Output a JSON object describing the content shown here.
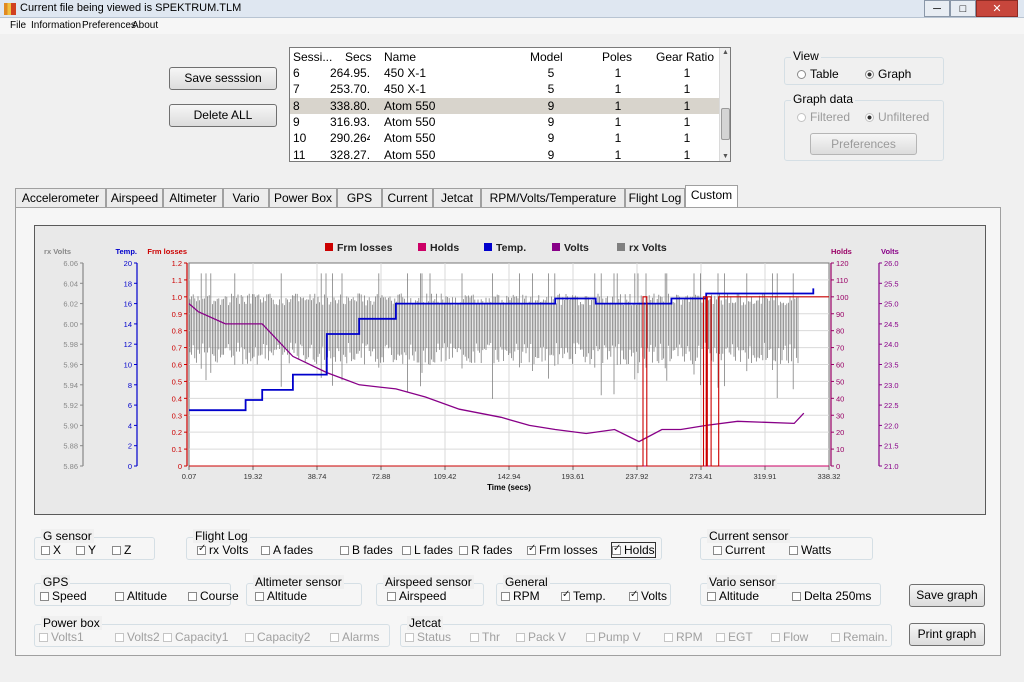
{
  "window": {
    "title": "Current file being viewed is SPEKTRUM.TLM",
    "minimize": "─",
    "maximize": "□",
    "close": "✕"
  },
  "menu": [
    "File",
    "Information",
    "Preferences",
    "About"
  ],
  "buttons": {
    "save_session": "Save sesssion",
    "delete_all": "Delete ALL",
    "preferences": "Preferences",
    "save_graph": "Save graph",
    "print_graph": "Print graph"
  },
  "sessions": {
    "headers": {
      "session": "Sessi...",
      "secs": "Secs",
      "name": "Name",
      "model": "Model",
      "poles": "Poles",
      "gear_ratio": "Gear Ratio"
    },
    "rows": [
      {
        "session": "6",
        "secs": "264.95...",
        "name": "450 X-1",
        "model": "5",
        "poles": "1",
        "gear": "1"
      },
      {
        "session": "7",
        "secs": "253.70...",
        "name": "450 X-1",
        "model": "5",
        "poles": "1",
        "gear": "1"
      },
      {
        "session": "8",
        "secs": "338.80...",
        "name": "Atom 550",
        "model": "9",
        "poles": "1",
        "gear": "1"
      },
      {
        "session": "9",
        "secs": "316.93...",
        "name": "Atom 550",
        "model": "9",
        "poles": "1",
        "gear": "1"
      },
      {
        "session": "10",
        "secs": "290.264",
        "name": "Atom 550",
        "model": "9",
        "poles": "1",
        "gear": "1"
      },
      {
        "session": "11",
        "secs": "328.27...",
        "name": "Atom 550",
        "model": "9",
        "poles": "1",
        "gear": "1"
      }
    ],
    "selected": 2
  },
  "view": {
    "title": "View",
    "table": "Table",
    "graph": "Graph",
    "selected": "graph"
  },
  "graph_data": {
    "title": "Graph data",
    "filtered": "Filtered",
    "unfiltered": "Unfiltered",
    "selected": "unfiltered"
  },
  "tabs": [
    {
      "label": "Accelerometer"
    },
    {
      "label": "Airspeed"
    },
    {
      "label": "Altimeter"
    },
    {
      "label": "Vario"
    },
    {
      "label": "Power Box"
    },
    {
      "label": "GPS"
    },
    {
      "label": "Current"
    },
    {
      "label": "Jetcat"
    },
    {
      "label": "RPM/Volts/Temperature"
    },
    {
      "label": "Flight Log"
    },
    {
      "label": "Custom"
    }
  ],
  "active_tab": 10,
  "chart_data": {
    "type": "line",
    "legend_position": "top",
    "series": [
      {
        "name": "Frm losses",
        "color": "#cc0000",
        "axis": "Frm losses",
        "x": [
          0.07,
          237.92,
          240,
          242,
          270,
          272,
          273.41,
          274,
          276,
          280,
          282,
          338.32
        ],
        "y": [
          0,
          0,
          1.0,
          0,
          0,
          1.0,
          0,
          1.0,
          0,
          1.0,
          1.0,
          1.0
        ]
      },
      {
        "name": "Holds",
        "color": "#cc0066",
        "axis": "Holds",
        "x": [
          0.07,
          338.32
        ],
        "y": [
          0,
          0
        ]
      },
      {
        "name": "Temp.",
        "color": "#0000cc",
        "axis": "Temp.",
        "x": [
          0.07,
          19.32,
          30,
          38.74,
          55,
          72.88,
          90,
          109.42,
          125,
          142.94,
          170,
          193.61,
          215,
          237.92,
          255,
          273.41,
          300,
          319.91,
          330
        ],
        "y": [
          5.5,
          5.5,
          6.5,
          7.5,
          9,
          13,
          14.5,
          16,
          16,
          16,
          16,
          16.5,
          16,
          16,
          16.5,
          17,
          17,
          17,
          17.5
        ]
      },
      {
        "name": "Volts",
        "color": "#880088",
        "axis": "Volts",
        "x": [
          0.07,
          5,
          19.32,
          38.74,
          55,
          72.88,
          90,
          109.42,
          125,
          142.94,
          165,
          180,
          193.61,
          210,
          225,
          237.92,
          250,
          260,
          273.41,
          290,
          319.91,
          325
        ],
        "y": [
          25.0,
          24.8,
          24.5,
          24.5,
          23.7,
          23.3,
          23.0,
          22.9,
          22.7,
          22.4,
          22.2,
          22.0,
          21.9,
          21.8,
          21.9,
          21.6,
          21.9,
          21.9,
          22.0,
          22.1,
          22.05,
          22.3
        ]
      },
      {
        "name": "rx Volts",
        "color": "#808080",
        "axis": "rx Volts",
        "band": [
          5.96,
          6.03
        ]
      }
    ],
    "x_axis": {
      "label": "Time (secs)",
      "ticks": [
        "0.07",
        "19.32",
        "38.74",
        "72.88",
        "109.42",
        "142.94",
        "193.61",
        "237.92",
        "273.41",
        "319.91",
        "338.32"
      ],
      "range": [
        0.07,
        338.32
      ]
    },
    "y_axes": [
      {
        "title": "rx Volts",
        "color": "#888888",
        "range": [
          5.86,
          6.06
        ],
        "ticks": [
          "6.06",
          "6.04",
          "6.02",
          "6.00",
          "5.98",
          "5.96",
          "5.94",
          "5.92",
          "5.90",
          "5.88",
          "5.86"
        ]
      },
      {
        "title": "Temp.",
        "color": "#0000cc",
        "range": [
          0,
          20
        ],
        "ticks": [
          "20",
          "18",
          "16",
          "14",
          "12",
          "10",
          "8",
          "6",
          "4",
          "2",
          "0"
        ]
      },
      {
        "title": "Frm losses",
        "color": "#cc0000",
        "range": [
          0,
          1.2
        ],
        "ticks": [
          "1.2",
          "1.1",
          "1.0",
          "0.9",
          "0.8",
          "0.7",
          "0.6",
          "0.5",
          "0.4",
          "0.3",
          "0.2",
          "0.1",
          "0"
        ]
      },
      {
        "title": "Holds",
        "color": "#990066",
        "range": [
          0,
          120
        ],
        "ticks": [
          "120",
          "110",
          "100",
          "90",
          "80",
          "70",
          "60",
          "50",
          "40",
          "30",
          "20",
          "10",
          "0"
        ]
      },
      {
        "title": "Volts",
        "color": "#880088",
        "range": [
          21.0,
          26.0
        ],
        "ticks": [
          "26.0",
          "25.5",
          "25.0",
          "24.5",
          "24.0",
          "23.5",
          "23.0",
          "22.5",
          "22.0",
          "21.5",
          "21.0"
        ]
      }
    ],
    "grid": true
  },
  "sensor_groups": {
    "g_sensor": {
      "title": "G sensor",
      "items": [
        {
          "label": "X",
          "checked": false
        },
        {
          "label": "Y",
          "checked": false
        },
        {
          "label": "Z",
          "checked": false
        }
      ]
    },
    "flight_log": {
      "title": "Flight Log",
      "items": [
        {
          "label": "rx Volts",
          "checked": true
        },
        {
          "label": "A fades",
          "checked": false
        },
        {
          "label": "B fades",
          "checked": false
        },
        {
          "label": "L fades",
          "checked": false
        },
        {
          "label": "R fades",
          "checked": false
        },
        {
          "label": "Frm losses",
          "checked": true
        },
        {
          "label": "Holds",
          "checked": true
        }
      ]
    },
    "current_sensor": {
      "title": "Current sensor",
      "items": [
        {
          "label": "Current",
          "checked": false
        },
        {
          "label": "Watts",
          "checked": false
        }
      ]
    },
    "gps": {
      "title": "GPS",
      "items": [
        {
          "label": "Speed",
          "checked": false
        },
        {
          "label": "Altitude",
          "checked": false
        },
        {
          "label": "Course",
          "checked": false
        }
      ]
    },
    "altimeter": {
      "title": "Altimeter sensor",
      "items": [
        {
          "label": "Altitude",
          "checked": false
        }
      ]
    },
    "airspeed": {
      "title": "Airspeed sensor",
      "items": [
        {
          "label": "Airspeed",
          "checked": false
        }
      ]
    },
    "general": {
      "title": "General",
      "items": [
        {
          "label": "RPM",
          "checked": false
        },
        {
          "label": "Temp.",
          "checked": true
        },
        {
          "label": "Volts",
          "checked": true
        }
      ]
    },
    "vario": {
      "title": "Vario sensor",
      "items": [
        {
          "label": "Altitude",
          "checked": false
        },
        {
          "label": "Delta 250ms",
          "checked": false
        }
      ]
    },
    "power_box": {
      "title": "Power box",
      "items": [
        {
          "label": "Volts1",
          "checked": false
        },
        {
          "label": "Volts2",
          "checked": false
        },
        {
          "label": "Capacity1",
          "checked": false
        },
        {
          "label": "Capacity2",
          "checked": false
        },
        {
          "label": "Alarms",
          "checked": false
        }
      ]
    },
    "jetcat": {
      "title": "Jetcat",
      "items": [
        {
          "label": "Status",
          "checked": false
        },
        {
          "label": "Thr",
          "checked": false
        },
        {
          "label": "Pack V",
          "checked": false
        },
        {
          "label": "Pump V",
          "checked": false
        },
        {
          "label": "RPM",
          "checked": false
        },
        {
          "label": "EGT",
          "checked": false
        },
        {
          "label": "Flow",
          "checked": false
        },
        {
          "label": "Remain.",
          "checked": false
        }
      ]
    }
  }
}
